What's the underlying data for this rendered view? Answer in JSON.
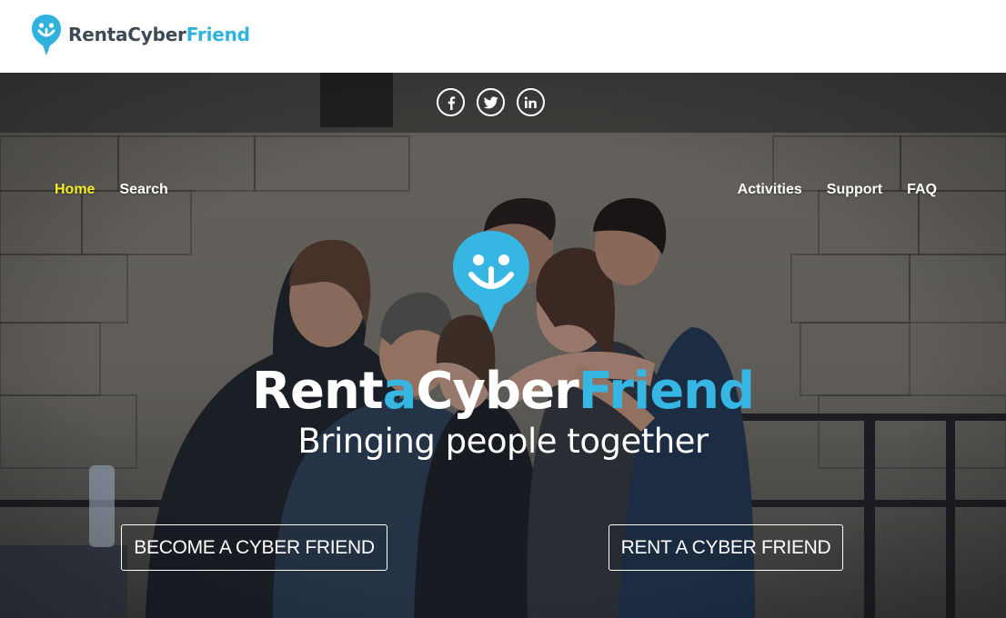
{
  "header": {
    "brand_part1": "RentaCyber",
    "brand_part2": "Friend",
    "icon": "smiley-pin-logo-icon"
  },
  "social": [
    {
      "name": "facebook-icon",
      "glyph": "f"
    },
    {
      "name": "twitter-icon",
      "glyph": "bird"
    },
    {
      "name": "linkedin-icon",
      "glyph": "in"
    }
  ],
  "nav": {
    "home": "Home",
    "search": "Search",
    "activities": "Activities",
    "support": "Support",
    "faq": "FAQ"
  },
  "hero": {
    "title_part1": "Rent",
    "title_part2": "a",
    "title_part3": "Cyber",
    "title_part4": "Friend",
    "tagline": "Bringing people together",
    "cta_become": "BECOME A CYBER FRIEND",
    "cta_rent": "RENT A CYBER FRIEND"
  },
  "colors": {
    "brand_blue": "#35b6e3",
    "brand_dark": "#3d4a55",
    "nav_active": "#f3ee2a",
    "white": "#ffffff"
  }
}
